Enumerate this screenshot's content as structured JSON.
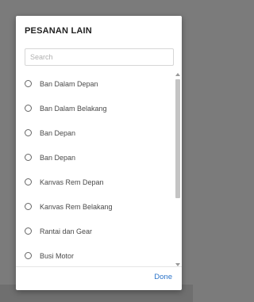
{
  "dialog": {
    "title": "PESANAN LAIN",
    "search": {
      "placeholder": "Search",
      "value": ""
    },
    "items": [
      {
        "label": "Ban Dalam Depan"
      },
      {
        "label": "Ban Dalam Belakang"
      },
      {
        "label": "Ban Depan"
      },
      {
        "label": "Ban Depan"
      },
      {
        "label": "Kanvas Rem Depan"
      },
      {
        "label": "Kanvas Rem Belakang"
      },
      {
        "label": "Rantai dan Gear"
      },
      {
        "label": "Busi Motor"
      }
    ],
    "done_label": "Done"
  },
  "colors": {
    "overlay": "#7b7b7b",
    "accent": "#2a73c9",
    "text": "#4a4a4a"
  }
}
